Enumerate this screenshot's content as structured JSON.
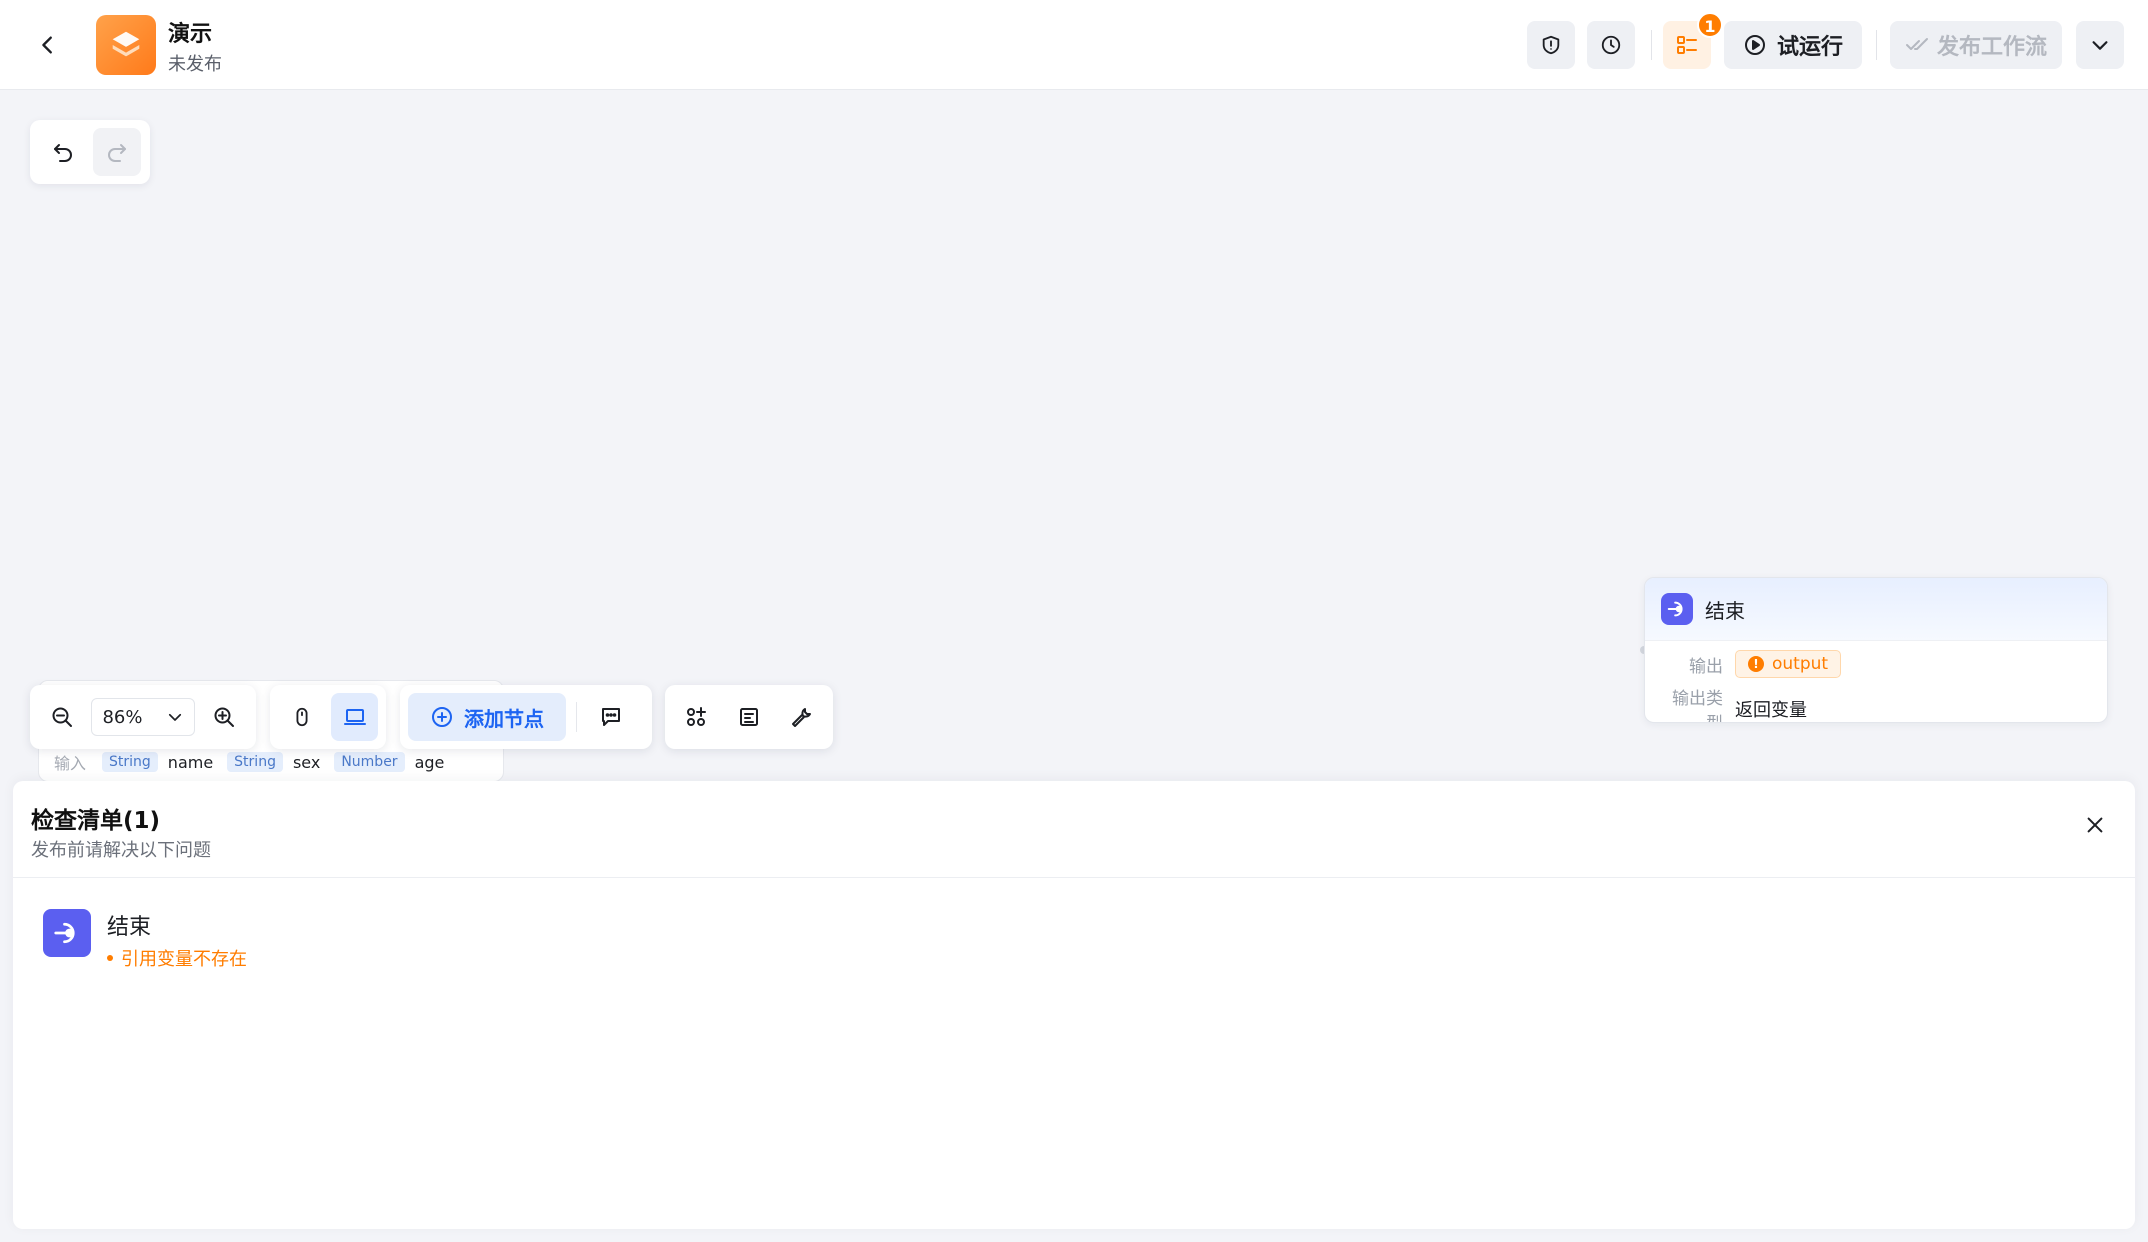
{
  "header": {
    "app_title": "演示",
    "app_status": "未发布",
    "checklist_badge": "1",
    "run_label": "试运行",
    "publish_label": "发布工作流"
  },
  "toolbar": {
    "zoom": "86%",
    "add_node_label": "添加节点"
  },
  "end_node": {
    "title": "结束",
    "output_label": "输出",
    "output_var": "output",
    "output_type_label": "输出类型",
    "output_type_value": "返回变量"
  },
  "start_node": {
    "input_label": "输入",
    "inputs": [
      {
        "type": "String",
        "name": "name"
      },
      {
        "type": "String",
        "name": "sex"
      },
      {
        "type": "Number",
        "name": "age"
      }
    ]
  },
  "checklist": {
    "title": "检查清单(1)",
    "subtitle": "发布前请解决以下问题",
    "items": [
      {
        "node": "结束",
        "error": "引用变量不存在"
      }
    ]
  },
  "colors": {
    "primary": "#1d64f2",
    "warning": "#ff7d00",
    "node_end": "#5b5ff0",
    "logo": "#ff8c2e"
  }
}
